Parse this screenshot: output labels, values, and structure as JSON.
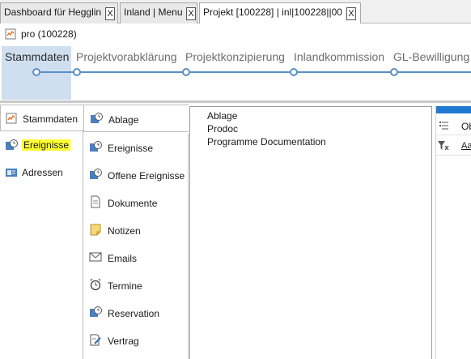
{
  "tabs": [
    {
      "label": "Dashboard für Hegglin",
      "close": "X"
    },
    {
      "label": "Inland | Menu",
      "close": "X"
    },
    {
      "label": "Projekt [100228] | inl|100228||00",
      "close": "X"
    }
  ],
  "title": "pro (100228)",
  "steps": [
    "Stammdaten",
    "Projektvorabklärung",
    "Projektkonzipierung",
    "Inlandkommission",
    "GL-Bewilligung"
  ],
  "left_nav": [
    "Stammdaten",
    "Ereignisse",
    "Adressen"
  ],
  "mid_nav": [
    "Ablage",
    "Ereignisse",
    "Offene Ereignisse",
    "Dokumente",
    "Notizen",
    "Emails",
    "Termine",
    "Reservation",
    "Vertrag"
  ],
  "list_items": [
    "Ablage",
    "Prodoc",
    "Programme Documentation"
  ],
  "right_panel": {
    "row1": "Ob",
    "row2": "Aa"
  },
  "colors": {
    "accent": "#5a8fc6",
    "active_step_bg": "#cfdff0",
    "highlight": "#ffff33",
    "header_blue": "#1f7ad1"
  }
}
